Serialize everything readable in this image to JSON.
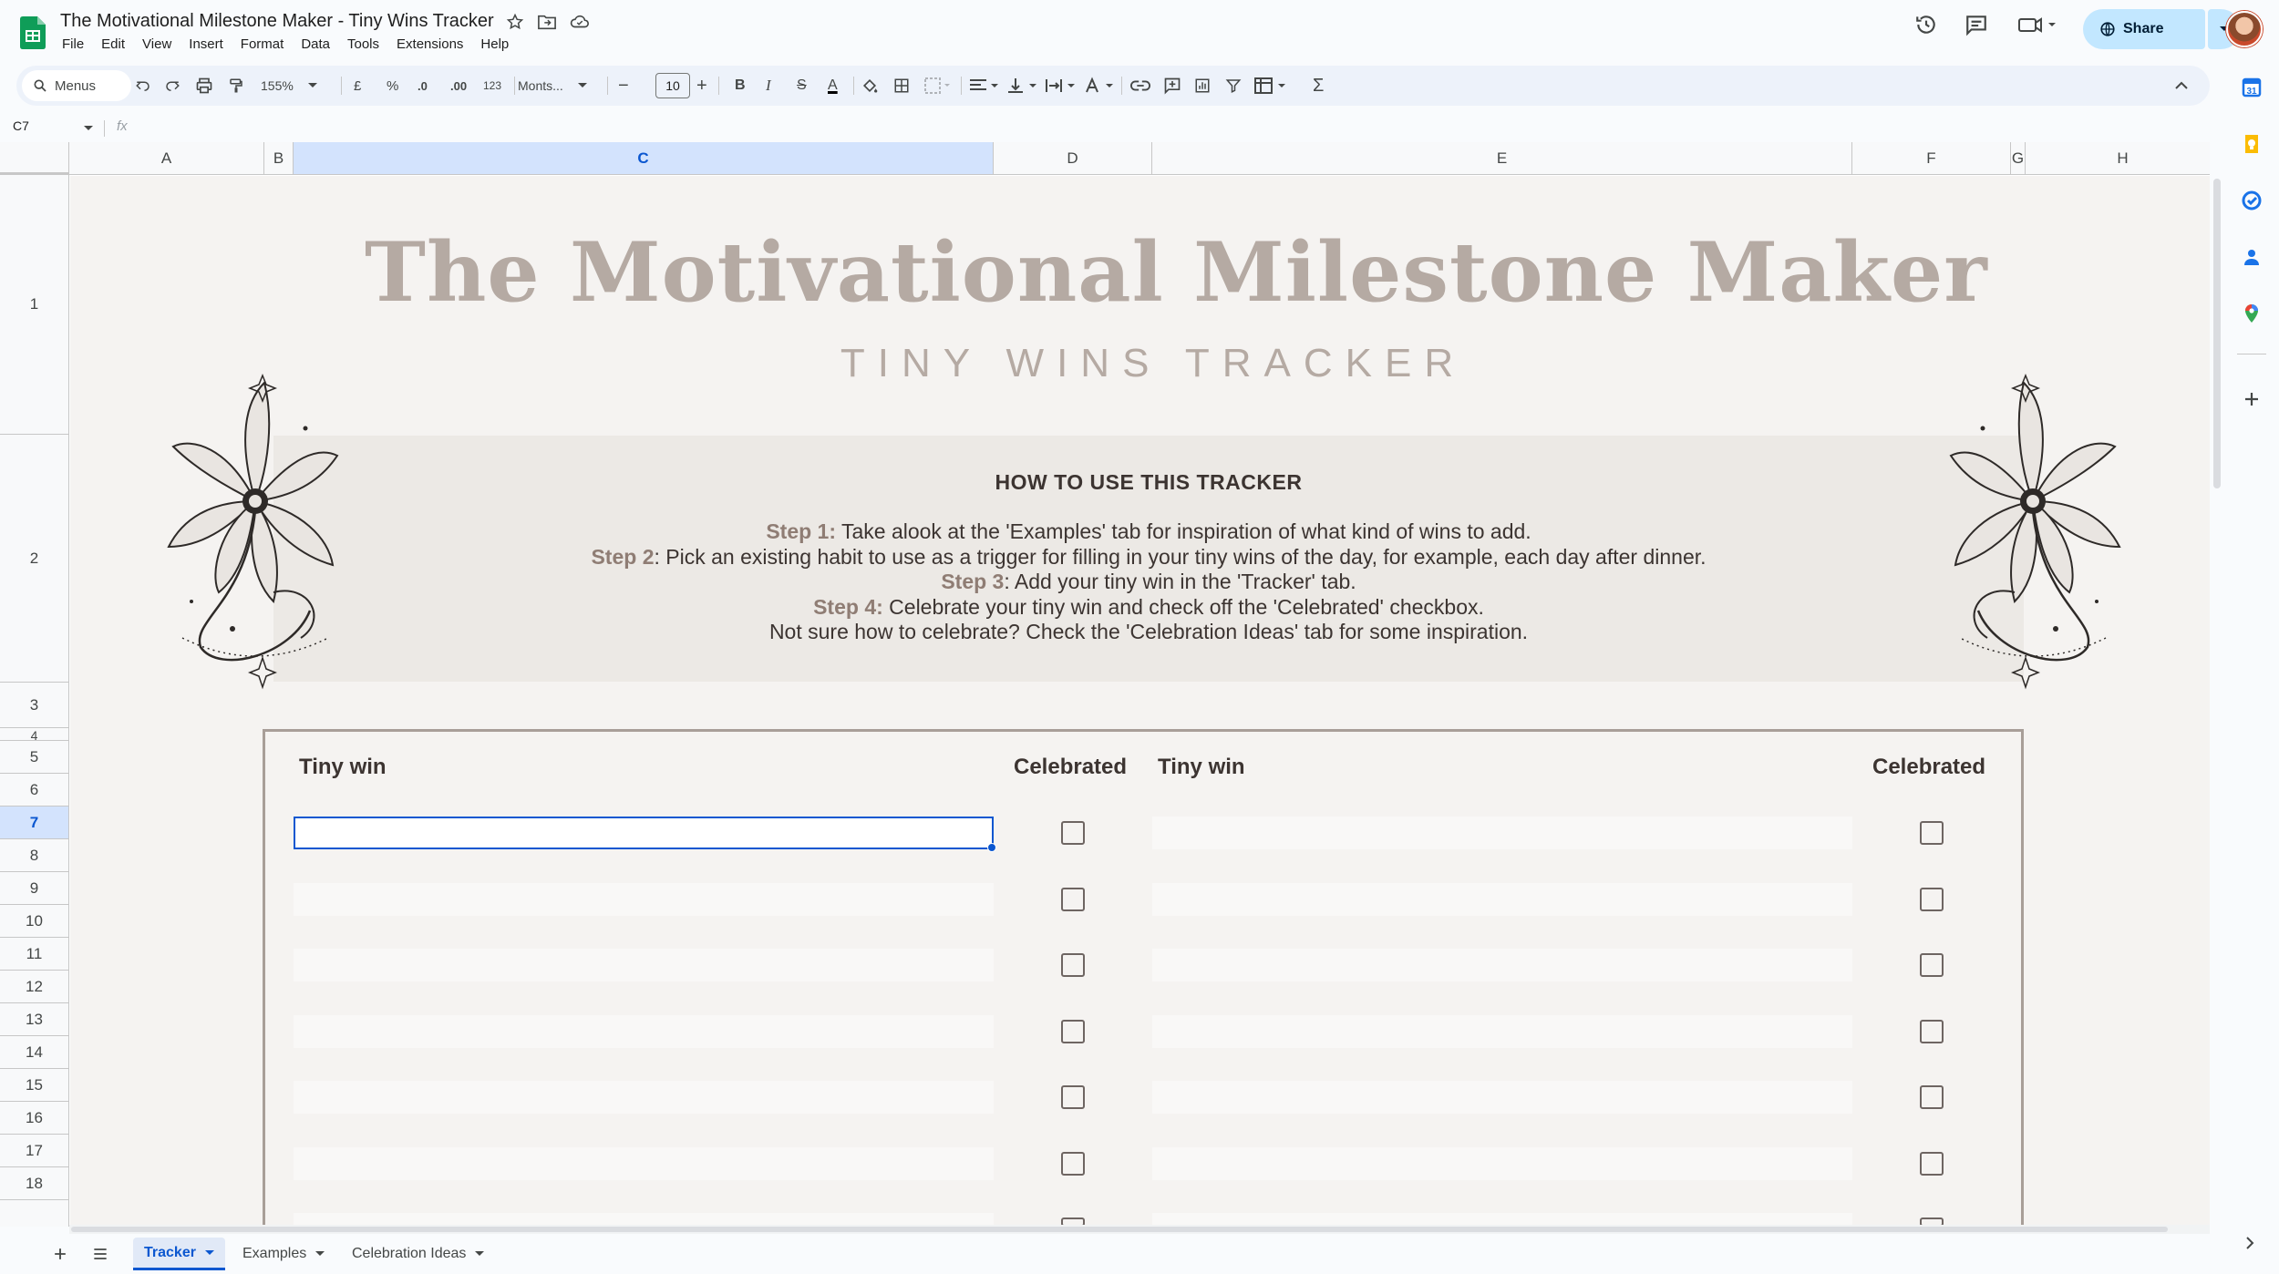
{
  "doc": {
    "title": "The Motivational Milestone Maker - Tiny Wins Tracker",
    "menus": [
      "File",
      "Edit",
      "View",
      "Insert",
      "Format",
      "Data",
      "Tools",
      "Extensions",
      "Help"
    ],
    "share_label": "Share"
  },
  "toolbar": {
    "search_label": "Menus",
    "zoom": "155%",
    "currency": "£",
    "percent": "%",
    "dec_decrease": ".0",
    "dec_increase": ".00",
    "number_format": "123",
    "font": "Monts...",
    "font_size": "10",
    "minus": "−",
    "plus": "+",
    "bold": "B",
    "italic": "I",
    "strike": "S",
    "text_color": "A",
    "sum": "Σ"
  },
  "formula": {
    "cell_ref": "C7",
    "fx": "fx",
    "value": ""
  },
  "columns": [
    "A",
    "B",
    "C",
    "D",
    "E",
    "F",
    "G",
    "H"
  ],
  "rows": [
    "1",
    "2",
    "3",
    "4",
    "5",
    "6",
    "7",
    "8",
    "9",
    "10",
    "11",
    "12",
    "13",
    "14",
    "15",
    "16",
    "17",
    "18"
  ],
  "selection": {
    "column": "C",
    "row": "7"
  },
  "content": {
    "title": "The Motivational Milestone Maker",
    "subtitle": "TINY WINS TRACKER",
    "howto_title": "HOW TO USE THIS TRACKER",
    "steps": [
      {
        "label": "Step 1:",
        "text": " Take alook at the 'Examples' tab for inspiration of what kind of wins to add."
      },
      {
        "label": "Step 2",
        "text": ": Pick an existing habit to use as a trigger for filling in your tiny wins of the day, for example, each day after dinner."
      },
      {
        "label": "Step 3",
        "text": ": Add your tiny win in the 'Tracker' tab."
      },
      {
        "label": "Step 4:",
        "text": " Celebrate your tiny win and check off the 'Celebrated' checkbox."
      },
      {
        "label": "",
        "text": "Not sure how to celebrate? Check the 'Celebration Ideas' tab for some inspiration."
      }
    ],
    "tracker_headers": {
      "win_left": "Tiny win",
      "celebrated_left": "Celebrated",
      "win_right": "Tiny win",
      "celebrated_right": "Celebrated"
    }
  },
  "tabs": [
    {
      "label": "Tracker",
      "active": true
    },
    {
      "label": "Examples",
      "active": false
    },
    {
      "label": "Celebration Ideas",
      "active": false
    }
  ],
  "icons": [
    "sheets-logo-icon",
    "star-icon",
    "move-folder-icon",
    "cloud-status-icon",
    "history-icon",
    "comments-icon",
    "meet-icon",
    "globe-icon",
    "search-icon",
    "undo-icon",
    "redo-icon",
    "print-icon",
    "paint-format-icon",
    "fill-color-icon",
    "borders-icon",
    "merge-icon",
    "align-icon",
    "valign-icon",
    "wrap-icon",
    "rotate-icon",
    "link-icon",
    "comment-add-icon",
    "chart-icon",
    "filter-icon",
    "table-icon",
    "collapse-icon",
    "calendar-icon",
    "keep-icon",
    "tasks-icon",
    "contacts-icon",
    "maps-icon",
    "add-icon",
    "flower-icon",
    "checkbox-icon",
    "sheet-list-icon"
  ],
  "colors": {
    "accent": "#0b57d0",
    "title": "#b5aaa3",
    "step_label": "#8f7d74",
    "text": "#3c3431",
    "panel": "#ece9e5",
    "page": "#f5f3f1"
  }
}
